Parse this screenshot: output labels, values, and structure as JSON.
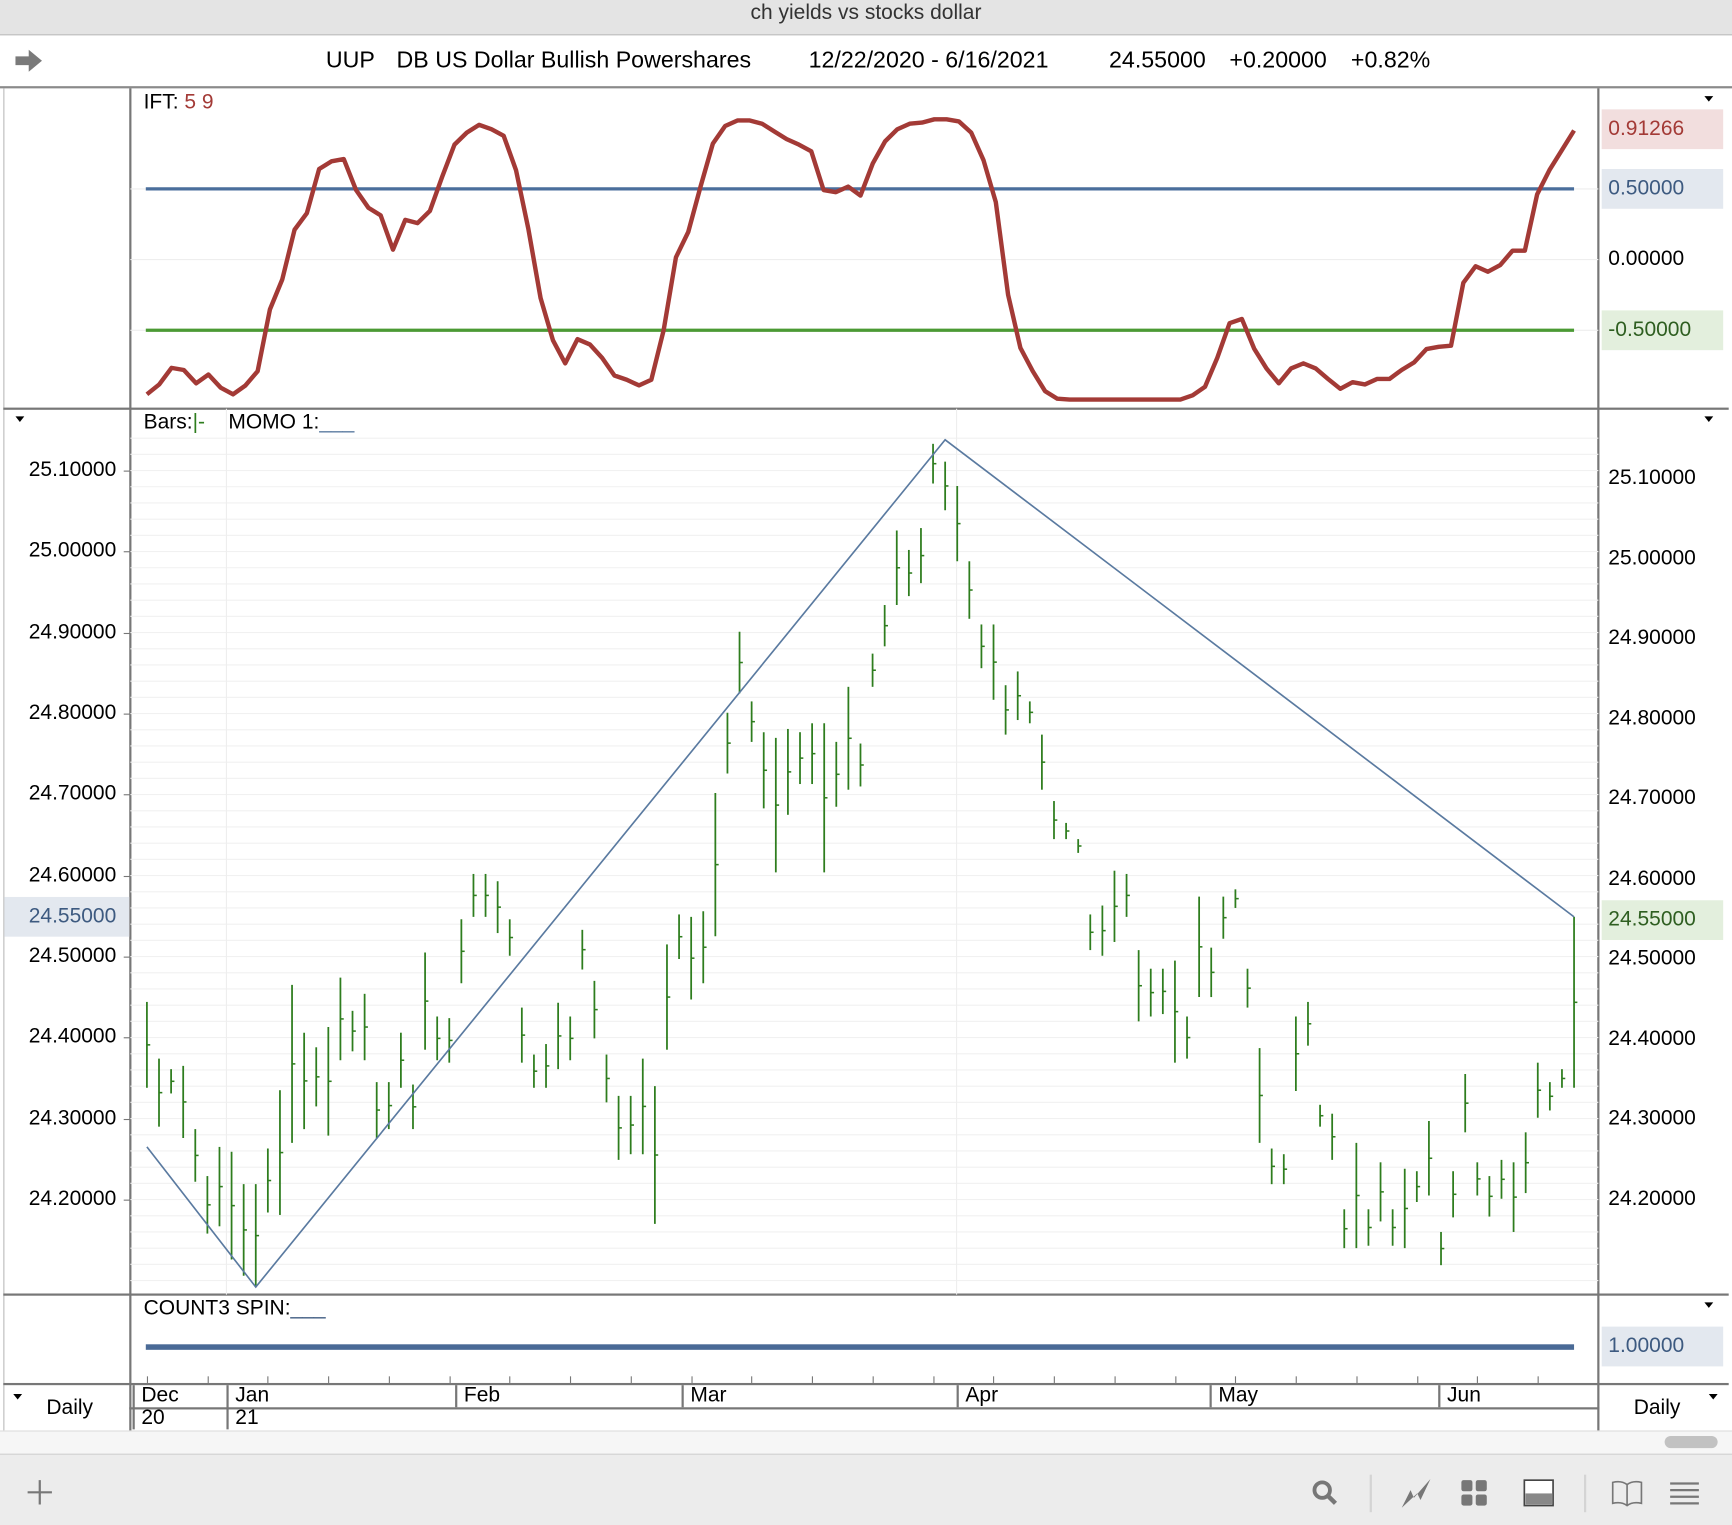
{
  "window_title": "ch yields vs stocks dollar",
  "header": {
    "symbol": "UUP",
    "name": "DB US Dollar Bullish Powershares",
    "date_range": "12/22/2020 - 6/16/2021",
    "last": "24.55000",
    "change": "+0.20000",
    "change_pct": "+0.82%"
  },
  "ift_panel": {
    "label": "IFT:",
    "params": "5 9",
    "current_value": "0.91266",
    "levels": [
      "0.50000",
      "0.00000",
      "-0.50000"
    ]
  },
  "price_panel": {
    "label_bars": "Bars:",
    "bars_glyph": "|-",
    "label_momo": "MOMO 1:",
    "current_price": "24.55000",
    "left_ticks": [
      "25.10000",
      "25.00000",
      "24.90000",
      "24.80000",
      "24.70000",
      "24.60000",
      "24.50000",
      "24.40000",
      "24.30000",
      "24.20000"
    ],
    "right_ticks": [
      "25.10000",
      "25.00000",
      "24.90000",
      "24.80000",
      "24.70000",
      "24.60000",
      "24.50000",
      "24.40000",
      "24.30000",
      "24.20000"
    ]
  },
  "count_panel": {
    "label": "COUNT3 SPIN:",
    "value": "1.00000"
  },
  "date_axis": {
    "period_left": "Daily",
    "period_right": "Daily",
    "months": [
      {
        "m": "Dec",
        "y": "20"
      },
      {
        "m": "Jan",
        "y": "21"
      },
      {
        "m": "Feb",
        "y": ""
      },
      {
        "m": "Mar",
        "y": ""
      },
      {
        "m": "Apr",
        "y": ""
      },
      {
        "m": "May",
        "y": ""
      },
      {
        "m": "Jun",
        "y": ""
      }
    ]
  },
  "colors": {
    "bars": "#2e7d1e",
    "ift": "#a33a36",
    "upper": "#4a6e9c",
    "lower": "#4b9a34",
    "momo": "#5a7aa0"
  },
  "chart_data": [
    {
      "type": "line",
      "title": "IFT 5 9",
      "ylim": [
        -1,
        1
      ],
      "upper_level": 0.5,
      "lower_level": -0.5,
      "values": [
        -0.953,
        -0.883,
        -0.766,
        -0.781,
        -0.875,
        -0.813,
        -0.906,
        -0.953,
        -0.891,
        -0.789,
        -0.352,
        -0.141,
        0.211,
        0.328,
        0.641,
        0.695,
        0.711,
        0.492,
        0.367,
        0.313,
        0.07,
        0.281,
        0.258,
        0.344,
        0.586,
        0.813,
        0.898,
        0.953,
        0.922,
        0.875,
        0.633,
        0.219,
        -0.273,
        -0.57,
        -0.734,
        -0.563,
        -0.6,
        -0.695,
        -0.82,
        -0.85,
        -0.89,
        -0.85,
        -0.5,
        0.016,
        0.195,
        0.516,
        0.82,
        0.945,
        0.984,
        0.984,
        0.961,
        0.906,
        0.852,
        0.813,
        0.766,
        0.492,
        0.477,
        0.516,
        0.453,
        0.68,
        0.836,
        0.922,
        0.961,
        0.969,
        0.992,
        0.992,
        0.977,
        0.898,
        0.703,
        0.406,
        -0.25,
        -0.625,
        -0.789,
        -0.93,
        -0.984,
        -0.99,
        -0.99,
        -0.99,
        -0.99,
        -0.99,
        -0.99,
        -0.99,
        -0.99,
        -0.99,
        -0.99,
        -0.96,
        -0.9,
        -0.695,
        -0.45,
        -0.42,
        -0.63,
        -0.77,
        -0.875,
        -0.77,
        -0.734,
        -0.77,
        -0.844,
        -0.914,
        -0.867,
        -0.883,
        -0.844,
        -0.844,
        -0.78,
        -0.727,
        -0.633,
        -0.617,
        -0.609,
        -0.164,
        -0.047,
        -0.086,
        -0.039,
        0.063,
        0.063,
        0.461,
        0.633,
        0.773,
        0.913
      ]
    },
    {
      "type": "bar",
      "subtype": "hl-bars",
      "title": "UUP Daily",
      "ylim": [
        24.08,
        25.16
      ],
      "high": [
        24.444,
        24.374,
        24.361,
        24.365,
        24.287,
        24.229,
        24.265,
        24.259,
        24.219,
        24.219,
        24.263,
        24.335,
        24.465,
        24.406,
        24.388,
        24.413,
        24.474,
        24.433,
        24.454,
        24.345,
        24.345,
        24.406,
        24.342,
        24.505,
        24.426,
        24.424,
        24.546,
        24.602,
        24.602,
        24.593,
        24.546,
        24.437,
        24.379,
        24.392,
        24.443,
        24.426,
        24.533,
        24.47,
        24.379,
        24.328,
        24.328,
        24.374,
        24.34,
        24.515,
        24.552,
        24.549,
        24.556,
        24.702,
        24.801,
        24.901,
        24.815,
        24.777,
        24.77,
        24.781,
        24.777,
        24.788,
        24.788,
        24.765,
        24.833,
        24.763,
        24.874,
        24.934,
        25.026,
        25.002,
        25.029,
        25.133,
        25.111,
        25.081,
        24.988,
        24.91,
        24.91,
        24.835,
        24.852,
        24.815,
        24.774,
        24.692,
        24.665,
        24.645,
        24.552,
        24.563,
        24.606,
        24.602,
        24.508,
        24.485,
        24.485,
        24.495,
        24.426,
        24.574,
        24.511,
        24.574,
        24.583,
        24.485,
        24.387,
        24.263,
        24.256,
        24.426,
        24.444,
        24.317,
        24.306,
        24.188,
        24.27,
        24.188,
        24.246,
        24.188,
        24.238,
        24.235,
        24.297,
        24.16,
        24.235,
        24.355,
        24.246,
        24.229,
        24.249,
        24.246,
        24.283,
        24.369,
        24.345,
        24.361,
        24.549
      ],
      "low": [
        24.338,
        24.29,
        24.331,
        24.276,
        24.222,
        24.158,
        24.167,
        24.126,
        24.106,
        24.092,
        24.184,
        24.181,
        24.27,
        24.287,
        24.315,
        24.279,
        24.372,
        24.383,
        24.372,
        24.276,
        24.287,
        24.338,
        24.287,
        24.385,
        24.372,
        24.369,
        24.467,
        24.549,
        24.549,
        24.529,
        24.501,
        24.369,
        24.338,
        24.338,
        24.361,
        24.372,
        24.484,
        24.399,
        24.32,
        24.249,
        24.256,
        24.256,
        24.17,
        24.385,
        24.497,
        24.447,
        24.467,
        24.525,
        24.726,
        24.825,
        24.765,
        24.683,
        24.604,
        24.675,
        24.713,
        24.713,
        24.604,
        24.685,
        24.706,
        24.71,
        24.833,
        24.883,
        24.934,
        24.945,
        24.961,
        25.084,
        25.051,
        24.988,
        24.917,
        24.856,
        24.817,
        24.774,
        24.792,
        24.788,
        24.706,
        24.645,
        24.645,
        24.628,
        24.508,
        24.501,
        24.518,
        24.549,
        24.42,
        24.426,
        24.429,
        24.369,
        24.374,
        24.45,
        24.45,
        24.522,
        24.56,
        24.437,
        24.27,
        24.219,
        24.219,
        24.334,
        24.39,
        24.29,
        24.249,
        24.14,
        24.14,
        24.143,
        24.173,
        24.143,
        24.14,
        24.197,
        24.205,
        24.119,
        24.178,
        24.283,
        24.205,
        24.179,
        24.201,
        24.16,
        24.208,
        24.301,
        24.31,
        24.338,
        24.338
      ]
    },
    {
      "type": "line",
      "title": "MOMO 1",
      "points": [
        {
          "bar": 0,
          "value": 24.265
        },
        {
          "bar": 9,
          "value": 24.092
        },
        {
          "bar": 66,
          "value": 25.138
        },
        {
          "bar": 118,
          "value": 24.549
        }
      ]
    },
    {
      "type": "line",
      "title": "COUNT3 SPIN",
      "values": [
        1.0
      ]
    }
  ]
}
